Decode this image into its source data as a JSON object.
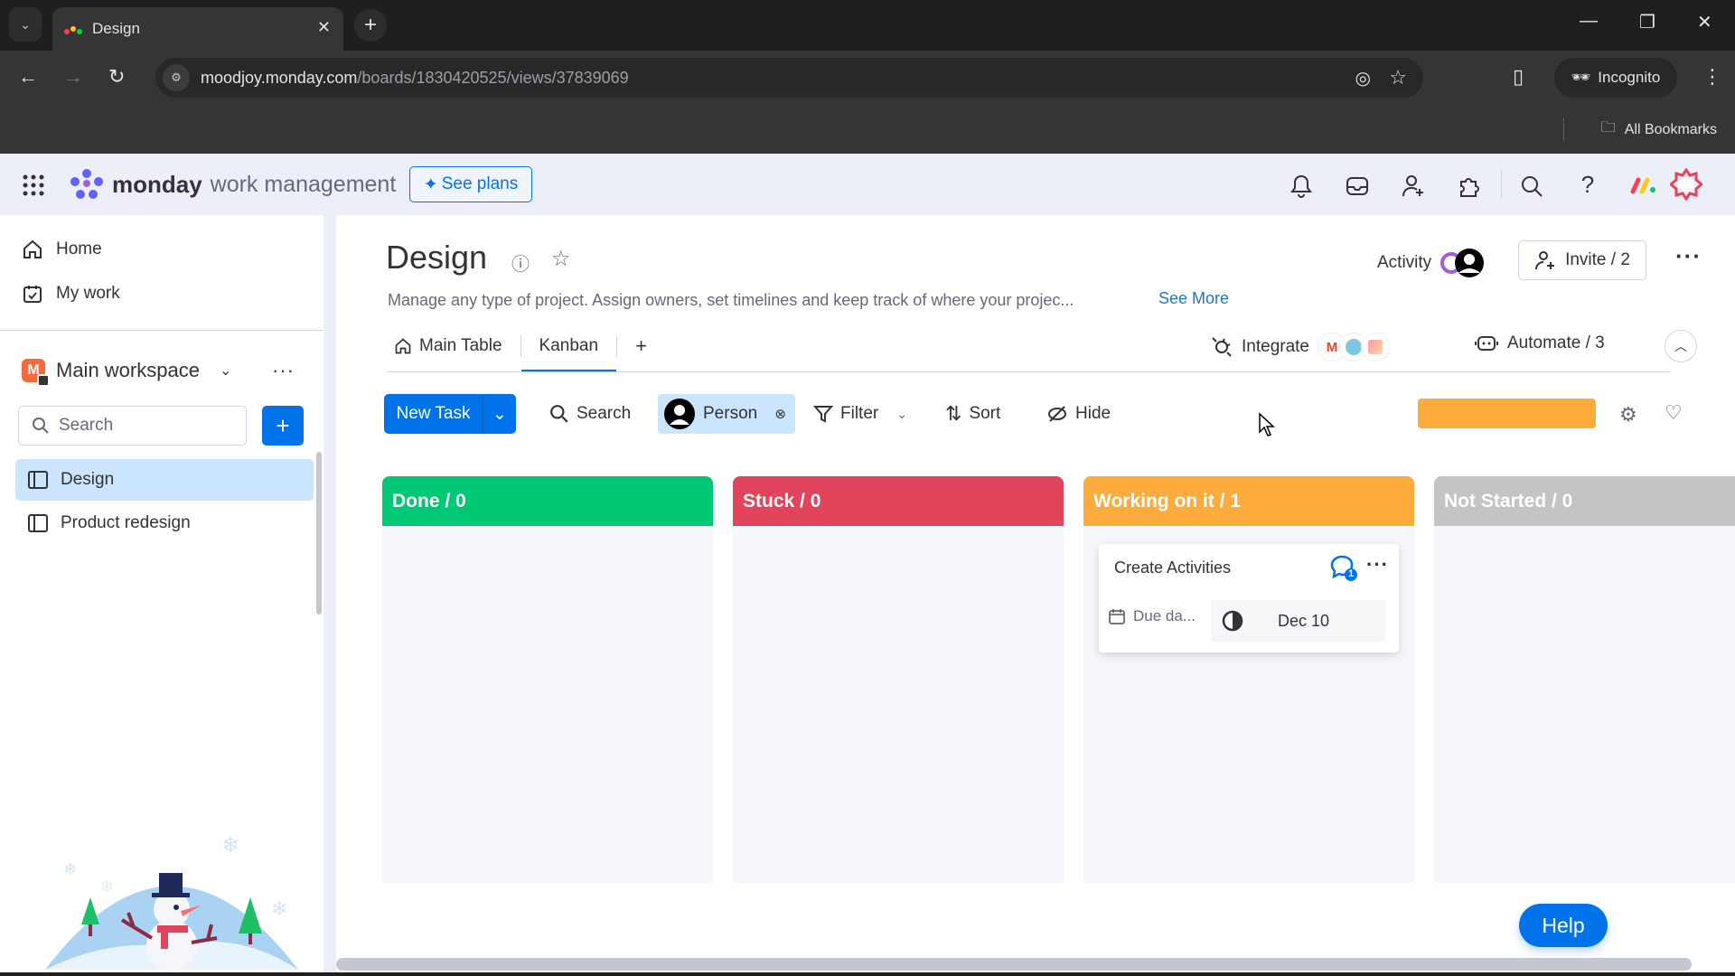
{
  "browser": {
    "tab_title": "Design",
    "url_host": "moodjoy.monday.com",
    "url_path": "/boards/1830420525/views/37839069",
    "incognito_label": "Incognito",
    "bookmarks_label": "All Bookmarks"
  },
  "topbar": {
    "brand_bold": "monday",
    "brand_rest": " work management",
    "see_plans": "See plans"
  },
  "sidebar": {
    "nav": [
      {
        "label": "Home",
        "icon": "home-icon"
      },
      {
        "label": "My work",
        "icon": "calendar-check-icon"
      }
    ],
    "workspace": {
      "badge": "M",
      "name": "Main workspace"
    },
    "search_placeholder": "Search",
    "boards": [
      {
        "label": "Design",
        "active": true
      },
      {
        "label": "Product redesign",
        "active": false
      }
    ]
  },
  "board": {
    "title": "Design",
    "description": "Manage any type of project. Assign owners, set timelines and keep track of where your projec...",
    "see_more": "See More",
    "activity_label": "Activity",
    "invite_label": "Invite / 2",
    "views": [
      {
        "label": "Main Table",
        "active": false
      },
      {
        "label": "Kanban",
        "active": true
      }
    ],
    "add_view": "+",
    "integrate_label": "Integrate",
    "automate_label": "Automate / 3"
  },
  "toolbar": {
    "new_task": "New Task",
    "search": "Search",
    "person": "Person",
    "filter": "Filter",
    "sort": "Sort",
    "hide": "Hide"
  },
  "kanban": {
    "columns": [
      {
        "label": "Done / 0",
        "color": "#00c875"
      },
      {
        "label": "Stuck / 0",
        "color": "#e2445c"
      },
      {
        "label": "Working on it / 1",
        "color": "#fdab3d"
      },
      {
        "label": "Not Started / 0",
        "color": "#c4c4c4"
      }
    ],
    "card": {
      "title": "Create Activities",
      "updates_count": "1",
      "date_label": "Due da...",
      "date_value": "Dec 10"
    }
  },
  "help_label": "Help"
}
